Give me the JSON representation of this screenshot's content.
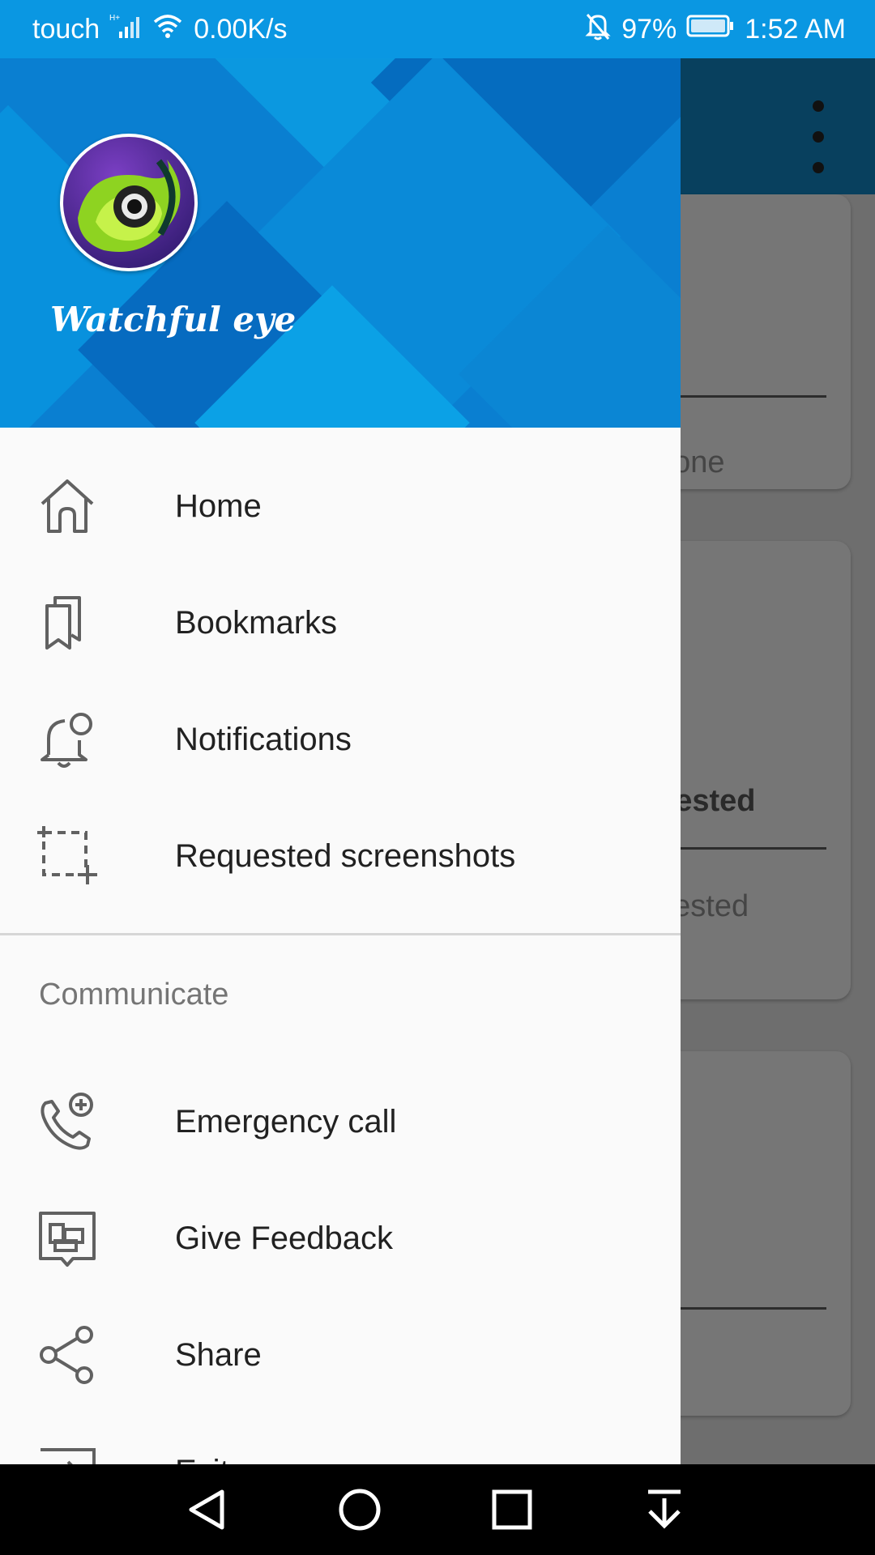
{
  "status_bar": {
    "carrier": "touch",
    "network_speed": "0.00K/s",
    "battery": "97%",
    "time": "1:52 AM"
  },
  "drawer": {
    "app_title": "Watchful eye",
    "menu_items": [
      {
        "label": "Home",
        "icon": "home-icon"
      },
      {
        "label": "Bookmarks",
        "icon": "bookmarks-icon"
      },
      {
        "label": "Notifications",
        "icon": "notifications-icon"
      },
      {
        "label": "Requested screenshots",
        "icon": "screenshot-icon"
      }
    ],
    "section_title": "Communicate",
    "communicate_items": [
      {
        "label": "Emergency call",
        "icon": "phone-add-icon"
      },
      {
        "label": "Give Feedback",
        "icon": "feedback-icon"
      },
      {
        "label": "Share",
        "icon": "share-icon"
      },
      {
        "label": "Exit",
        "icon": "exit-icon"
      }
    ]
  },
  "background": {
    "text_1": "eone",
    "text_2": "uested",
    "text_3": "uested"
  },
  "colors": {
    "status_bar": "#0a97e2",
    "drawer_header": "#0a7fd1",
    "toolbar": "#08405e"
  }
}
